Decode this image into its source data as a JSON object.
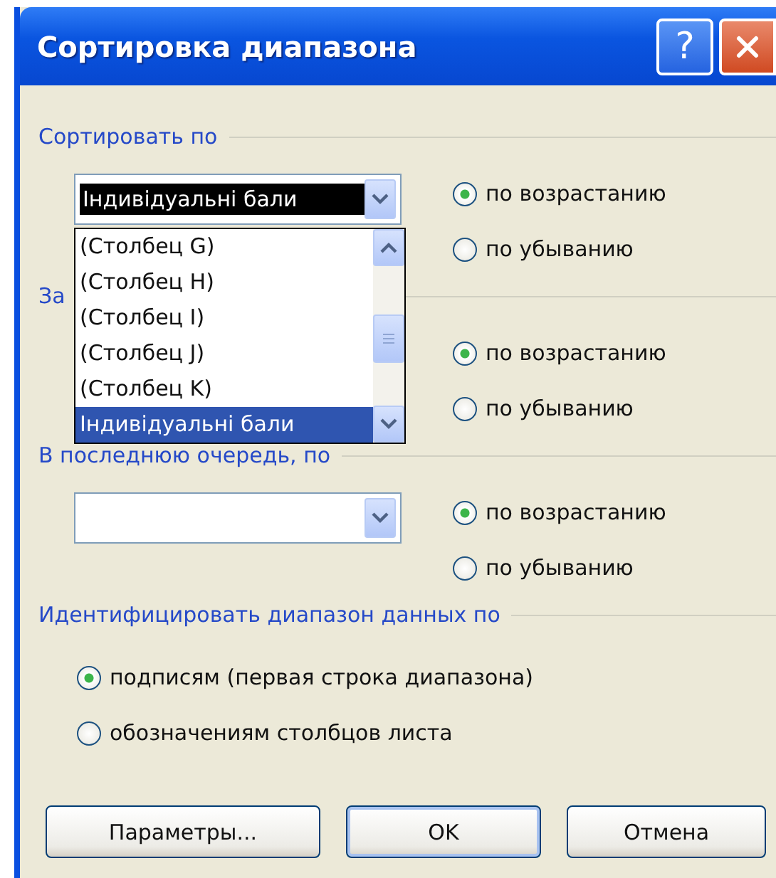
{
  "window": {
    "title": "Сортировка диапазона",
    "help": "?"
  },
  "groups": [
    {
      "label": "Сортировать по",
      "combo": {
        "value": "Індивідуальні бали",
        "focused": true
      },
      "options": [
        {
          "label": "по возрастанию",
          "selected": true
        },
        {
          "label": "по убыванию",
          "selected": false
        }
      ]
    },
    {
      "label": "За",
      "options": [
        {
          "label": "по возрастанию",
          "selected": true
        },
        {
          "label": "по убыванию",
          "selected": false
        }
      ]
    },
    {
      "label": "В последнюю очередь, по",
      "combo": {
        "focused": false
      },
      "options": [
        {
          "label": "по возрастанию",
          "selected": true
        },
        {
          "label": "по убыванию",
          "selected": false
        }
      ]
    }
  ],
  "dropdown": {
    "items": [
      {
        "label": "(Столбец G)",
        "selected": false
      },
      {
        "label": "(Столбец H)",
        "selected": false
      },
      {
        "label": "(Столбец I)",
        "selected": false
      },
      {
        "label": "(Столбец J)",
        "selected": false
      },
      {
        "label": "(Столбец K)",
        "selected": false
      },
      {
        "label": "Індивідуальні бали",
        "selected": true
      }
    ]
  },
  "identify": {
    "label": "Идентифицировать диапазон данных по",
    "options": [
      {
        "label": "подписям (первая строка диапазона)",
        "selected": true
      },
      {
        "label": "обозначениям столбцов листа",
        "selected": false
      }
    ]
  },
  "buttons": [
    {
      "label": "Параметры...",
      "default": false
    },
    {
      "label": "OK",
      "default": true
    },
    {
      "label": "Отмена",
      "default": false
    }
  ]
}
